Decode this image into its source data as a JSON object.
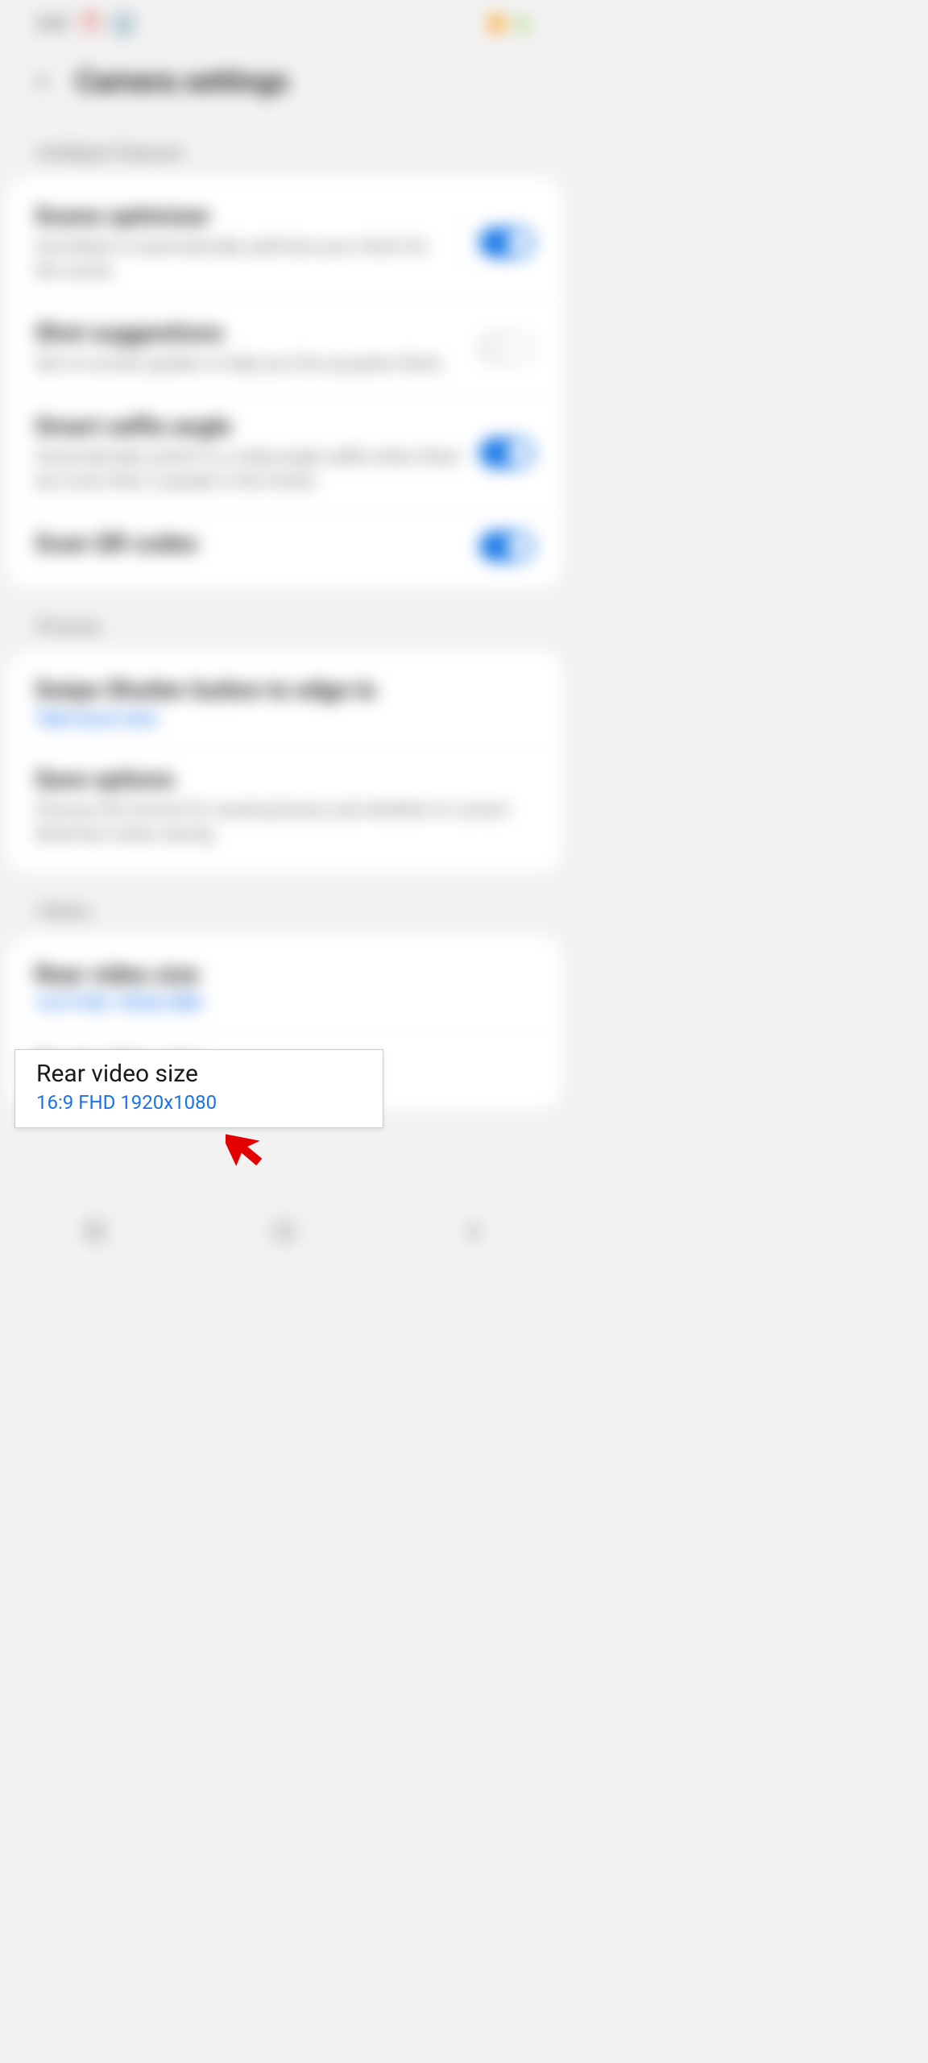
{
  "statusBar": {
    "time": "3:51",
    "icons": [
      "alarm-icon",
      "refresh-icon"
    ],
    "rightIcons": [
      "signal-icon",
      "wifi-icon",
      "battery-icon"
    ]
  },
  "header": {
    "title": "Camera settings"
  },
  "sections": [
    {
      "label": "Intelligent features",
      "rows": [
        {
          "title": "Scene optimizer",
          "subtitle": "Use Bixby to automatically optimize your shots for the scene.",
          "toggle": true,
          "hasDivider": true
        },
        {
          "title": "Shot suggestions",
          "subtitle": "Get on-screen guides to help you line up great shots.",
          "toggle": false
        },
        {
          "title": "Smart selfie angle",
          "subtitle": "Automatically switch to a wide-angle selfie when there are more than 2 people in the frame.",
          "toggle": true
        },
        {
          "title": "Scan QR codes",
          "toggle": true
        }
      ]
    },
    {
      "label": "Pictures",
      "rows": [
        {
          "title": "Swipe Shutter button to edge to",
          "value": "Take burst shot"
        },
        {
          "title": "Save options",
          "subtitle": "Choose the format for saved pictures and whether to correct distortion when saving."
        }
      ]
    },
    {
      "label": "Videos",
      "rows": [
        {
          "title": "Rear video size",
          "value": "16:9 FHD 1920x1080"
        },
        {
          "title": "Front video size"
        }
      ]
    }
  ],
  "highlight": {
    "title": "Rear video size",
    "value": "16:9 FHD 1920x1080"
  }
}
